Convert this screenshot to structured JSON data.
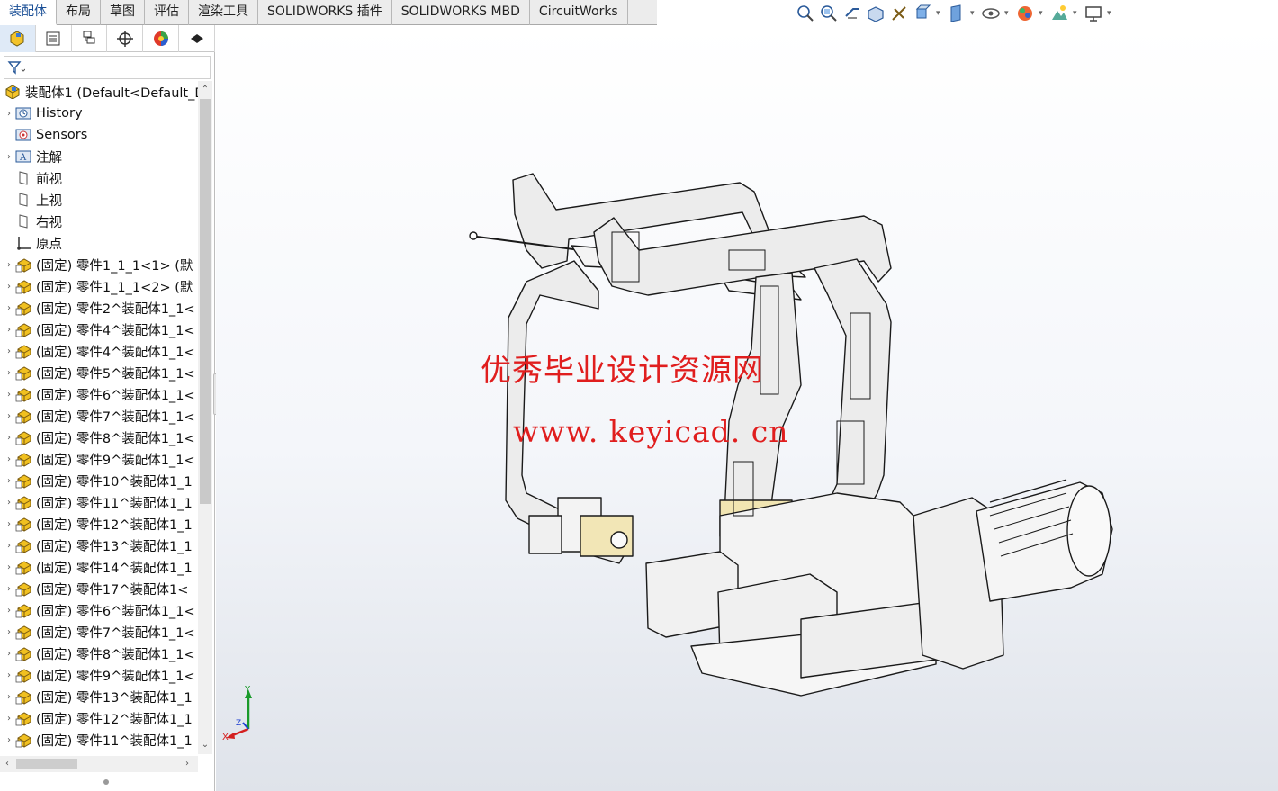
{
  "tabs": [
    {
      "label": "装配体",
      "active": true
    },
    {
      "label": "布局",
      "active": false
    },
    {
      "label": "草图",
      "active": false
    },
    {
      "label": "评估",
      "active": false
    },
    {
      "label": "渲染工具",
      "active": false
    },
    {
      "label": "SOLIDWORKS 插件",
      "active": false
    },
    {
      "label": "SOLIDWORKS MBD",
      "active": false
    },
    {
      "label": "CircuitWorks",
      "active": false
    }
  ],
  "hud_icons": [
    "zoom-to-fit-icon",
    "zoom-to-area-icon",
    "previous-view-icon",
    "section-view-icon",
    "dynamic-annotation-icon",
    "view-orientation-icon",
    "display-style-icon",
    "hide-show-items-icon",
    "edit-appearance-icon",
    "apply-scene-icon",
    "view-settings-icon"
  ],
  "pane_tabs": [
    "featuremanager-icon",
    "propertymanager-icon",
    "configurationmanager-icon",
    "dimxpertmanager-icon",
    "displaymanager-icon",
    "cam-icon"
  ],
  "tree": {
    "root": "装配体1  (Default<Default_D",
    "items": [
      {
        "label": "History",
        "icon": "history-folder-icon",
        "expand": true
      },
      {
        "label": "Sensors",
        "icon": "sensors-folder-icon",
        "expand": false
      },
      {
        "label": "注解",
        "icon": "annotations-folder-icon",
        "expand": true
      },
      {
        "label": "前视",
        "icon": "plane-icon",
        "expand": false
      },
      {
        "label": "上视",
        "icon": "plane-icon",
        "expand": false
      },
      {
        "label": "右视",
        "icon": "plane-icon",
        "expand": false
      },
      {
        "label": "原点",
        "icon": "origin-icon",
        "expand": false
      },
      {
        "label": "(固定) 零件1_1_1<1> (默",
        "icon": "part-icon",
        "expand": true
      },
      {
        "label": "(固定) 零件1_1_1<2> (默",
        "icon": "part-icon",
        "expand": true
      },
      {
        "label": "(固定) 零件2^装配体1_1<",
        "icon": "part-icon",
        "expand": true
      },
      {
        "label": "(固定) 零件4^装配体1_1<",
        "icon": "part-icon",
        "expand": true
      },
      {
        "label": "(固定) 零件4^装配体1_1<",
        "icon": "part-icon",
        "expand": true
      },
      {
        "label": "(固定) 零件5^装配体1_1<",
        "icon": "part-icon",
        "expand": true
      },
      {
        "label": "(固定) 零件6^装配体1_1<",
        "icon": "part-icon",
        "expand": true
      },
      {
        "label": "(固定) 零件7^装配体1_1<",
        "icon": "part-icon",
        "expand": true
      },
      {
        "label": "(固定) 零件8^装配体1_1<",
        "icon": "part-icon",
        "expand": true
      },
      {
        "label": "(固定) 零件9^装配体1_1<",
        "icon": "part-icon",
        "expand": true
      },
      {
        "label": "(固定) 零件10^装配体1_1",
        "icon": "part-icon",
        "expand": true
      },
      {
        "label": "(固定) 零件11^装配体1_1",
        "icon": "part-icon",
        "expand": true
      },
      {
        "label": "(固定) 零件12^装配体1_1",
        "icon": "part-icon",
        "expand": true
      },
      {
        "label": "(固定) 零件13^装配体1_1",
        "icon": "part-icon",
        "expand": true
      },
      {
        "label": "(固定) 零件14^装配体1_1",
        "icon": "part-icon",
        "expand": true
      },
      {
        "label": "(固定) 零件17^装配体1<",
        "icon": "part-icon",
        "expand": true
      },
      {
        "label": "(固定) 零件6^装配体1_1<",
        "icon": "part-icon",
        "expand": true
      },
      {
        "label": "(固定) 零件7^装配体1_1<",
        "icon": "part-icon",
        "expand": true
      },
      {
        "label": "(固定) 零件8^装配体1_1<",
        "icon": "part-icon",
        "expand": true
      },
      {
        "label": "(固定) 零件9^装配体1_1<",
        "icon": "part-icon",
        "expand": true
      },
      {
        "label": "(固定) 零件13^装配体1_1",
        "icon": "part-icon",
        "expand": true
      },
      {
        "label": "(固定) 零件12^装配体1_1",
        "icon": "part-icon",
        "expand": true
      },
      {
        "label": "(固定) 零件11^装配体1_1",
        "icon": "part-icon",
        "expand": true
      }
    ]
  },
  "watermark": {
    "line1": "优秀毕业设计资源网",
    "line2": "www. keyicad. cn",
    "color": "#e01e1e"
  },
  "triad": {
    "x": "X",
    "y": "Y",
    "z": "Z"
  },
  "colors": {
    "active_tab_text": "#1a4f96",
    "part_icon": "#f0c020",
    "axis_x": "#d42020",
    "axis_y": "#1a9a2a",
    "axis_z": "#2040d0"
  }
}
